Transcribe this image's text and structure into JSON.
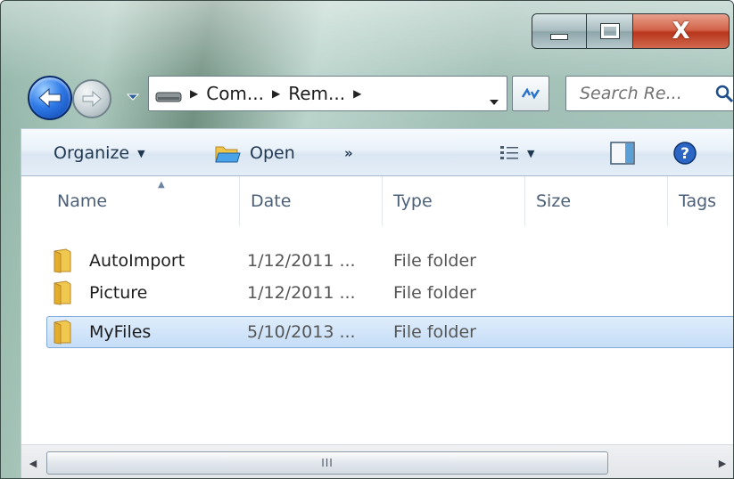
{
  "window": {
    "controls": {
      "minimize": "minimize",
      "maximize": "maximize",
      "close": "X"
    }
  },
  "navigation": {
    "breadcrumbs": [
      {
        "label": "Com..."
      },
      {
        "label": "Rem..."
      }
    ]
  },
  "search": {
    "placeholder": "Search Re..."
  },
  "toolbar": {
    "organize_label": "Organize",
    "open_label": "Open",
    "more_label": "»"
  },
  "columns": {
    "name": "Name",
    "date": "Date",
    "type": "Type",
    "size": "Size",
    "tags": "Tags"
  },
  "files": [
    {
      "name": "AutoImport",
      "date": "1/12/2011 ...",
      "type": "File folder",
      "selected": false
    },
    {
      "name": "Picture",
      "date": "1/12/2011 ...",
      "type": "File folder",
      "selected": false
    },
    {
      "name": "MyFiles",
      "date": "5/10/2013 ...",
      "type": "File folder",
      "selected": true
    }
  ],
  "scrollbar": {
    "thumb_grip": "III"
  },
  "colors": {
    "selection_fill": "#c5ddf7",
    "selection_border": "#84acd8",
    "header_text": "#4c6078",
    "close_button": "#c8452b"
  },
  "icons": {
    "back": "back-arrow-icon",
    "forward": "forward-arrow-icon",
    "drive": "drive-icon",
    "refresh": "refresh-icon",
    "search": "search-icon",
    "open": "open-folder-icon",
    "views": "views-list-icon",
    "preview": "preview-pane-icon",
    "help": "help-icon",
    "folder": "folder-icon"
  }
}
